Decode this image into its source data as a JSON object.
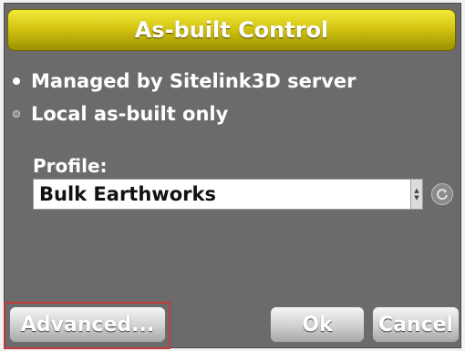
{
  "dialog": {
    "title": "As-built Control"
  },
  "options": [
    {
      "label": "Managed by Sitelink3D server",
      "selected": true
    },
    {
      "label": "Local as-built only",
      "selected": false
    }
  ],
  "profile": {
    "label": "Profile:",
    "value": "Bulk Earthworks"
  },
  "icons": {
    "select_arrows": "up-down-arrows-icon",
    "refresh": "refresh-icon"
  },
  "buttons": {
    "advanced": "Advanced...",
    "ok": "Ok",
    "cancel": "Cancel"
  },
  "colors": {
    "title_bar": "#d4c512",
    "panel": "#6b6b6b",
    "highlight_outline": "#c23a3a"
  }
}
